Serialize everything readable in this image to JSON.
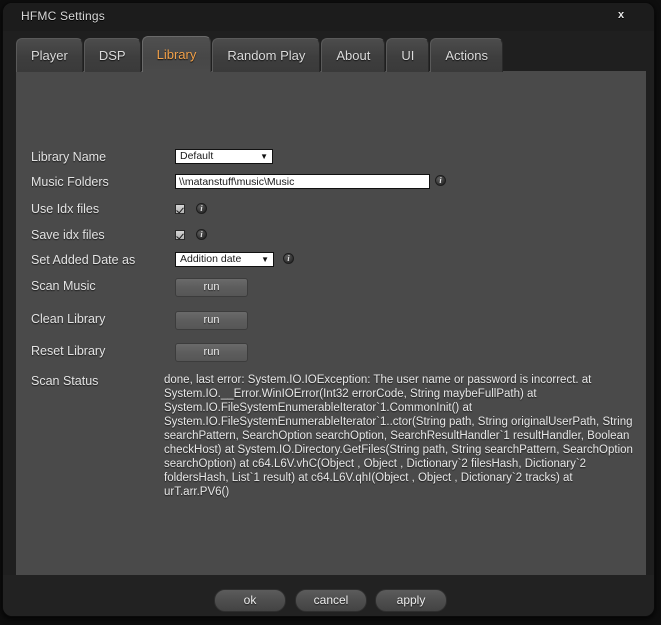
{
  "window": {
    "title": "HFMC Settings",
    "close_label": "x"
  },
  "tabs": [
    {
      "label": "Player",
      "active": false
    },
    {
      "label": "DSP",
      "active": false
    },
    {
      "label": "Library",
      "active": true
    },
    {
      "label": "Random Play",
      "active": false
    },
    {
      "label": "About",
      "active": false
    },
    {
      "label": "UI",
      "active": false
    },
    {
      "label": "Actions",
      "active": false
    }
  ],
  "library": {
    "library_name_label": "Library Name",
    "library_name_value": "Default",
    "music_folders_label": "Music Folders",
    "music_folders_value": "\\\\matanstuff\\music\\Music",
    "music_folders_placeholder": "",
    "use_idx_label": "Use Idx files",
    "save_idx_label": "Save idx files",
    "set_added_date_label": "Set Added Date as",
    "set_added_date_value": "Addition date",
    "scan_music_label": "Scan Music",
    "clean_library_label": "Clean Library",
    "reset_library_label": "Reset Library",
    "run_label": "run",
    "scan_status_label": "Scan Status",
    "scan_status_value": "done, last error: System.IO.IOException: The user name or password is incorrect.  at System.IO.__Error.WinIOError(Int32 errorCode, String maybeFullPath) at System.IO.FileSystemEnumerableIterator`1.CommonInit() at System.IO.FileSystemEnumerableIterator`1..ctor(String path, String originalUserPath, String searchPattern, SearchOption searchOption, SearchResultHandler`1 resultHandler, Boolean checkHost) at System.IO.Directory.GetFiles(String path, String searchPattern, SearchOption searchOption) at c64.L6V.vhC(Object , Object , Dictionary`2 filesHash, Dictionary`2 foldersHash, List`1 result) at c64.L6V.qhI(Object , Object , Dictionary`2 tracks) at urT.arr.PV6()",
    "info_icon": "info-icon",
    "dropdown_arrow": "▼"
  },
  "footer": {
    "ok_label": "ok",
    "cancel_label": "cancel",
    "apply_label": "apply"
  },
  "colors": {
    "accent": "#f2a14a",
    "panel_bg": "#4a4a4a",
    "window_bg": "#1f1f1f"
  }
}
